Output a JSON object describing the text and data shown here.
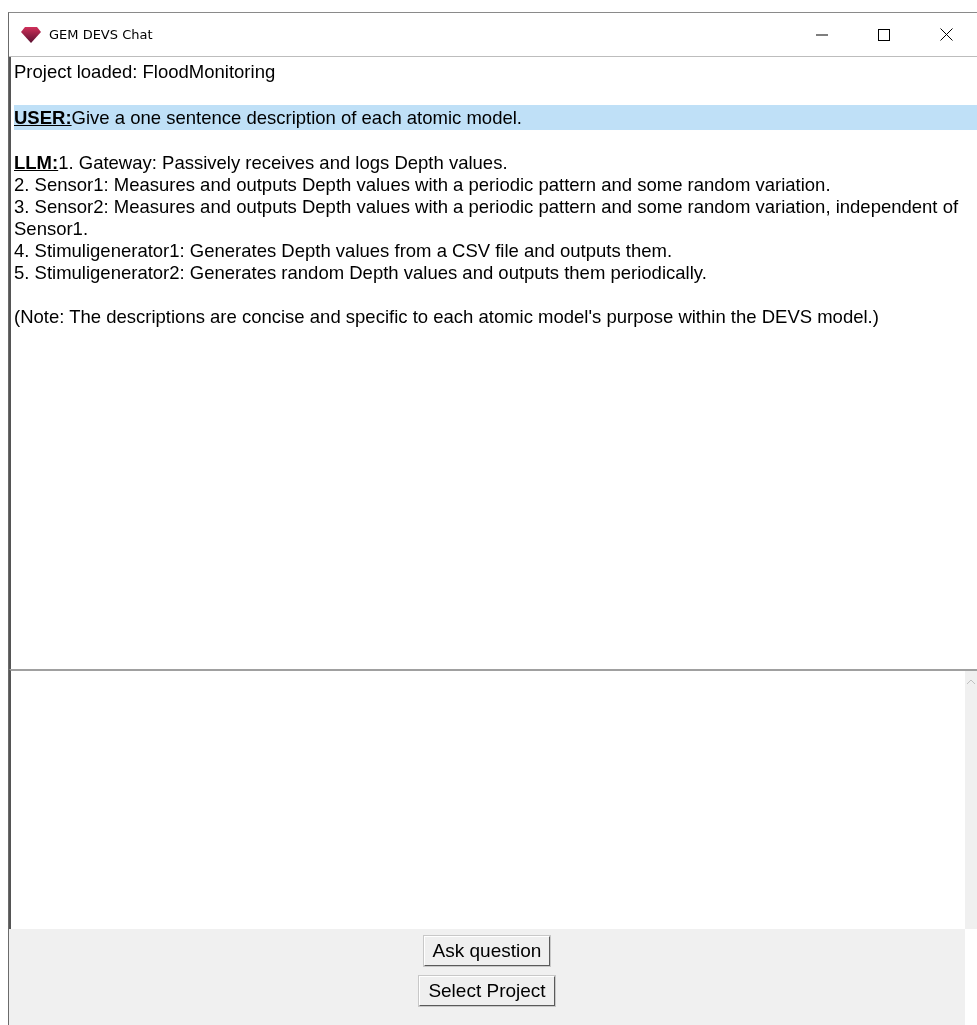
{
  "window": {
    "title": "GEM DEVS Chat"
  },
  "chat": [
    {
      "kind": "system",
      "text": "Project loaded: FloodMonitoring"
    },
    {
      "kind": "user",
      "speaker": "USER:",
      "text": "Give a one sentence description of each atomic model."
    },
    {
      "kind": "llm",
      "speaker": "LLM:",
      "items": [
        "1. Gateway: Passively receives and logs Depth values.",
        "2. Sensor1: Measures and outputs Depth values with a periodic pattern and some random variation.",
        "3. Sensor2: Measures and outputs Depth values with a periodic pattern and some random variation, independent of Sensor1.",
        "4. Stimuligenerator1: Generates Depth values from a CSV file and outputs them.",
        "5. Stimuligenerator2: Generates random Depth values and outputs them periodically."
      ],
      "note": "(Note: The descriptions are concise and specific to each atomic model's purpose within the DEVS model.)"
    }
  ],
  "buttons": [
    "Ask question",
    "Select Project"
  ]
}
